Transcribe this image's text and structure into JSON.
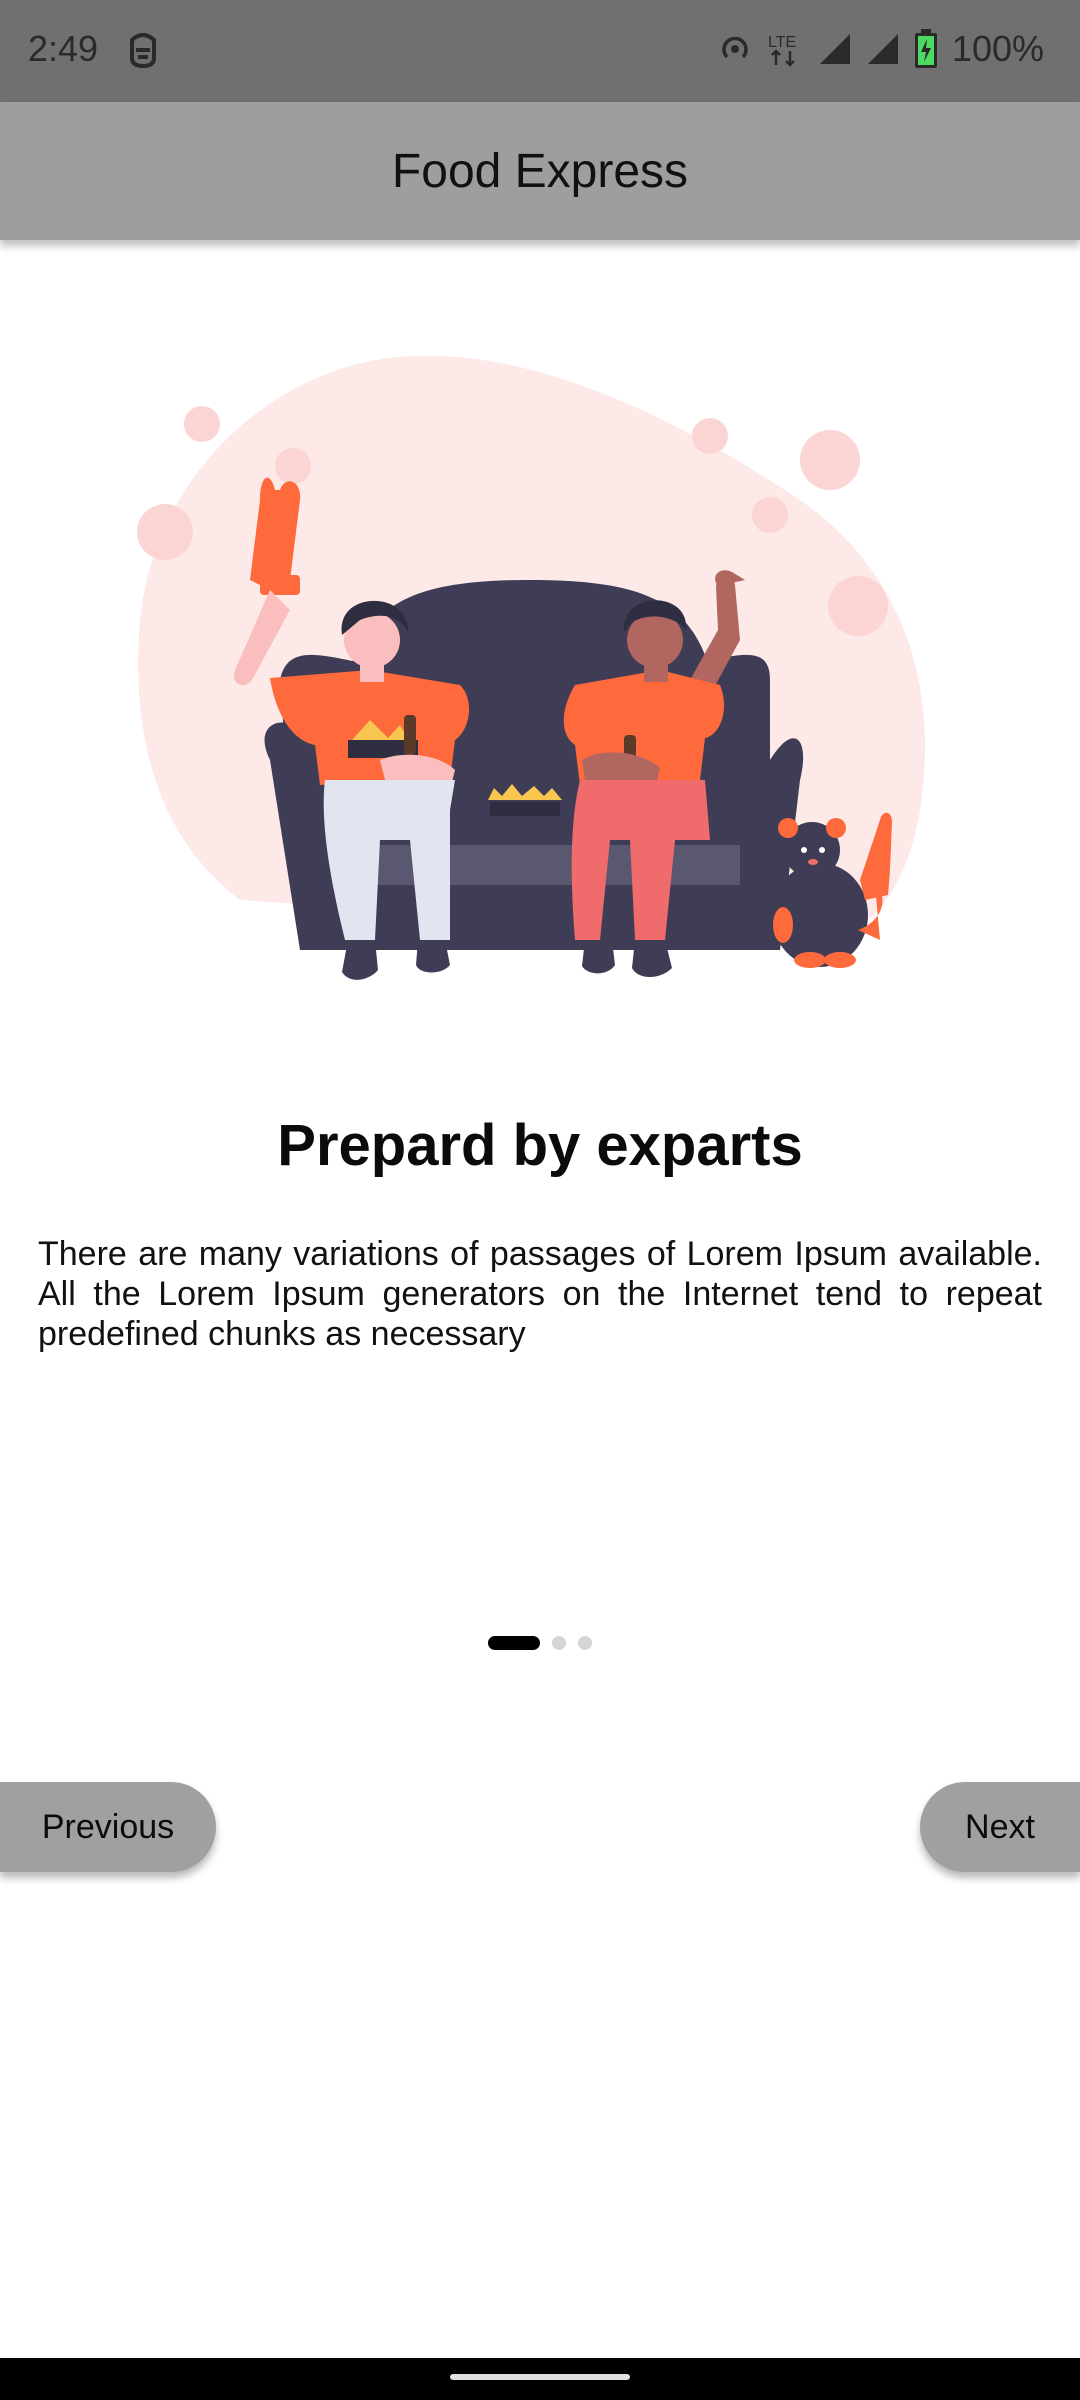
{
  "status_bar": {
    "time": "2:49",
    "battery": "100%",
    "icons": [
      "android-debug-icon",
      "hotspot-icon",
      "lte-icon",
      "signal-icon",
      "signal-icon",
      "battery-charging-icon"
    ]
  },
  "app_bar": {
    "title": "Food Express"
  },
  "onboarding": {
    "illustration": "two-fans-on-couch-illustration",
    "title": "Prepard by exparts",
    "description": "There are many variations of passages of Lorem Ipsum available. All the Lorem Ipsum generators on the Internet tend to repeat predefined chunks as necessary",
    "page_count": 3,
    "current_page": 1
  },
  "buttons": {
    "previous_label": "Previous",
    "next_label": "Next"
  },
  "colors": {
    "status_bar": "#707070",
    "app_bar": "#9e9e9e",
    "button": "#a0a0a0",
    "accent": "#ff6a3d",
    "blob": "#fde9e8",
    "sofa": "#3f3d56"
  }
}
